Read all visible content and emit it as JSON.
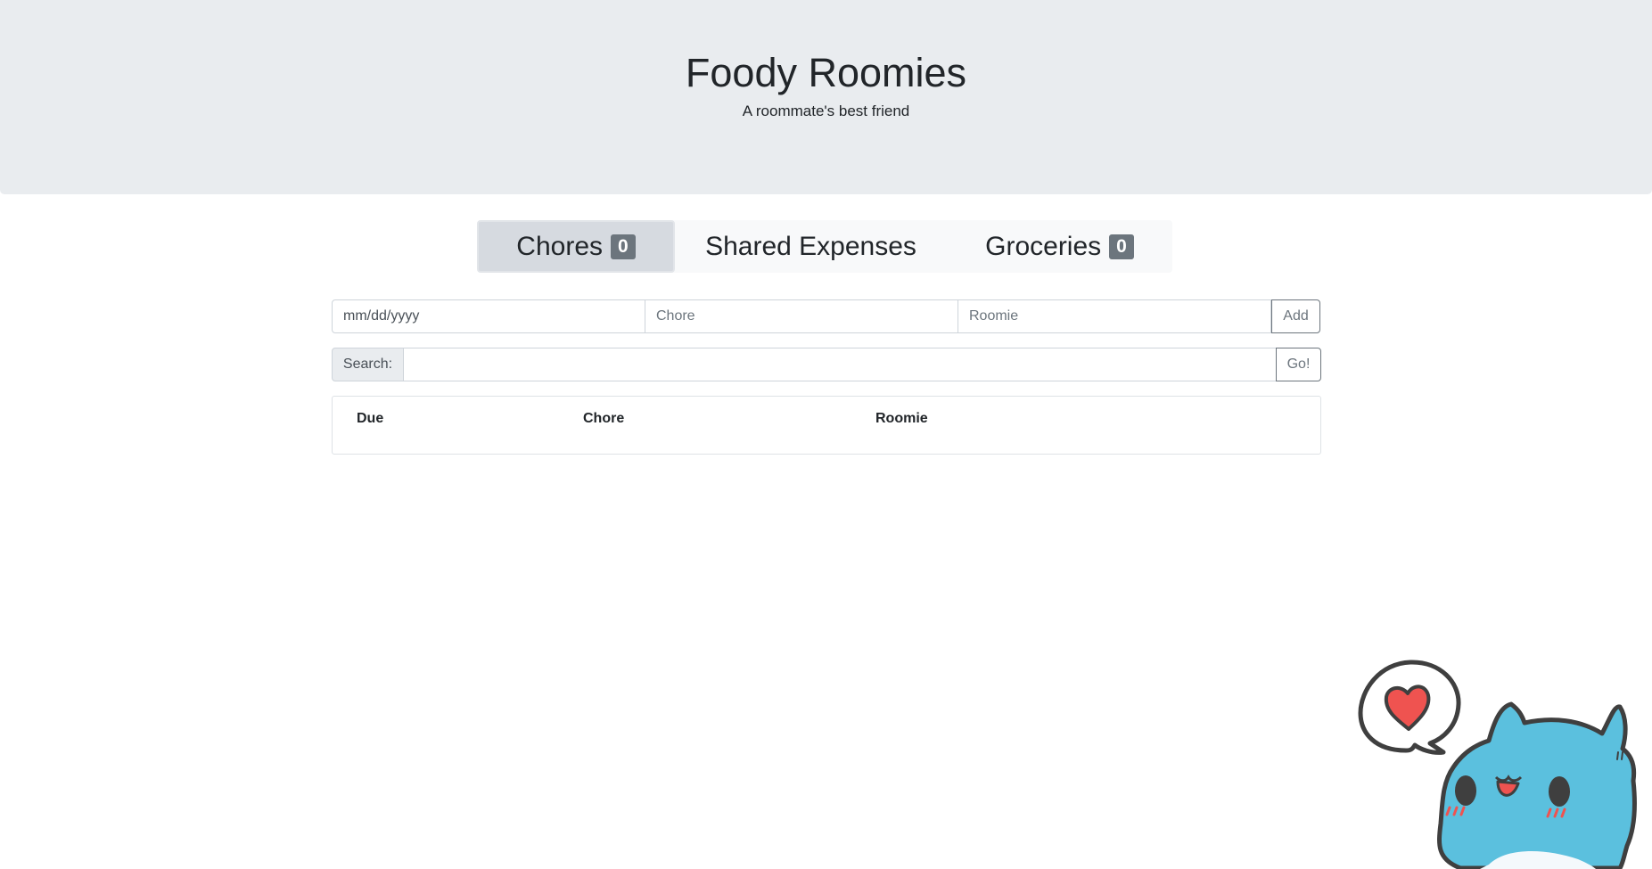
{
  "header": {
    "title": "Foody Roomies",
    "subtitle": "A roommate's best friend"
  },
  "tabs": [
    {
      "label": "Chores",
      "badge": "0",
      "active": true
    },
    {
      "label": "Shared Expenses",
      "badge": null,
      "active": false
    },
    {
      "label": "Groceries",
      "badge": "0",
      "active": false
    }
  ],
  "add_form": {
    "date_placeholder": "mm/dd/yyyy",
    "chore_placeholder": "Chore",
    "roomie_placeholder": "Roomie",
    "add_label": "Add"
  },
  "search": {
    "label": "Search:",
    "value": "",
    "go_label": "Go!"
  },
  "table": {
    "headers": [
      "Due",
      "Chore",
      "Roomie"
    ],
    "rows": []
  },
  "mascot": {
    "icon": "bugcat-heart-mascot",
    "body_color": "#5bc0de",
    "heart_color": "#ef5350"
  }
}
